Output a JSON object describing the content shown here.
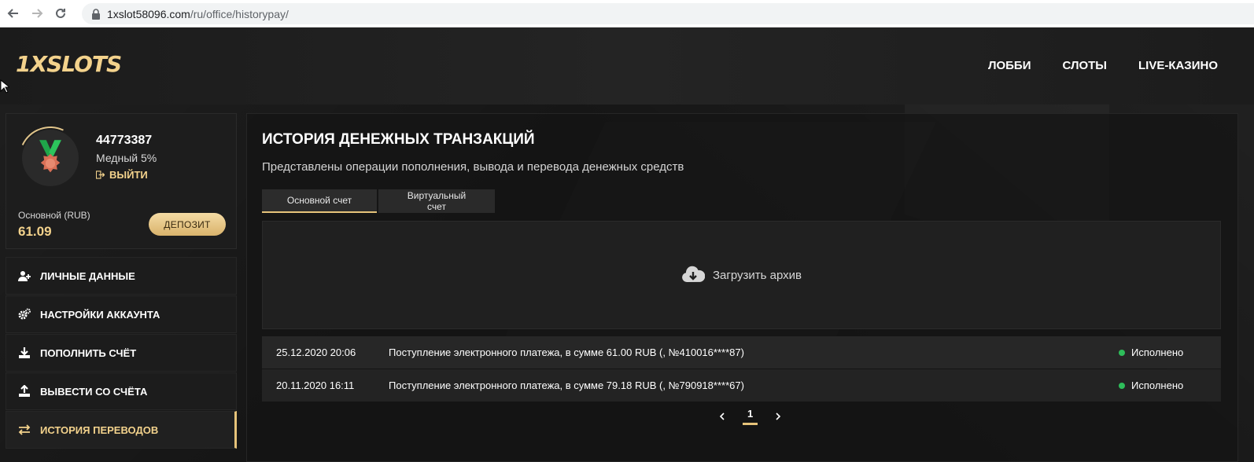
{
  "browser": {
    "url_host": "1xslot58096.com",
    "url_path": "/ru/office/historypay/"
  },
  "header": {
    "logo_text": "1XSLOTS",
    "nav": [
      "ЛОББИ",
      "СЛОТЫ",
      "LIVE-КАЗИНО"
    ]
  },
  "profile": {
    "user_id": "44773387",
    "level": "Медный 5%",
    "logout_label": "ВЫЙТИ",
    "balance_label": "Основной (RUB)",
    "balance_value": "61.09",
    "deposit_label": "ДЕПОЗИТ"
  },
  "sidebar": {
    "items": [
      {
        "label": "ЛИЧНЫЕ ДАННЫЕ",
        "icon": "user-plus-icon"
      },
      {
        "label": "НАСТРОЙКИ АККАУНТА",
        "icon": "gears-icon"
      },
      {
        "label": "ПОПОЛНИТЬ СЧЁТ",
        "icon": "download-icon"
      },
      {
        "label": "ВЫВЕСТИ СО СЧЁТА",
        "icon": "upload-icon"
      },
      {
        "label": "ИСТОРИЯ ПЕРЕВОДОВ",
        "icon": "transfer-arrows-icon",
        "active": true
      }
    ]
  },
  "main": {
    "title": "ИСТОРИЯ ДЕНЕЖНЫХ ТРАНЗАКЦИЙ",
    "subtitle": "Представлены операции пополнения, вывода и перевода денежных средств",
    "tabs": [
      "Основной счет",
      "Виртуальный счет"
    ],
    "archive_label": "Загрузить архив",
    "transactions": [
      {
        "date": "25.12.2020 20:06",
        "description": "Поступление электронного платежа, в сумме 61.00 RUB (, №410016****87)",
        "status": "Исполнено"
      },
      {
        "date": "20.11.2020 16:11",
        "description": "Поступление электронного платежа, в сумме 79.18 RUB (, №790918****67)",
        "status": "Исполнено"
      }
    ],
    "pagination": {
      "current": "1"
    }
  },
  "colors": {
    "accent_gold": "#e6c37a",
    "status_green": "#2ebd5a",
    "background": "#161616"
  }
}
